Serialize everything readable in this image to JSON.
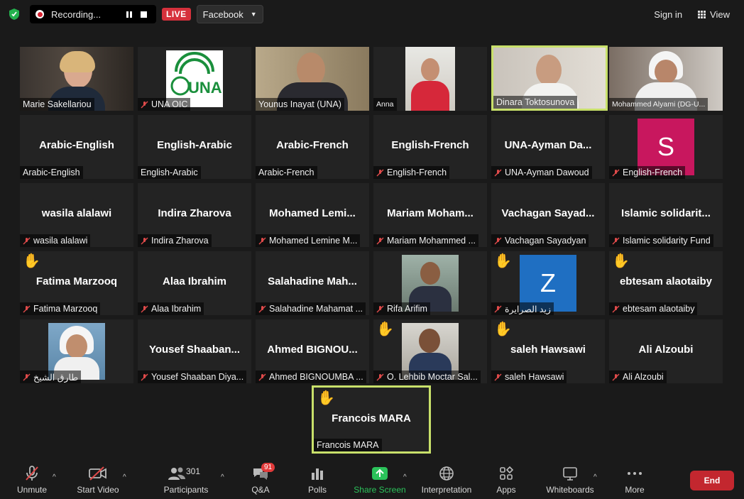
{
  "topbar": {
    "recording_label": "Recording...",
    "live_label": "LIVE",
    "stream_target": "Facebook",
    "signin_label": "Sign in",
    "view_label": "View"
  },
  "tiles": {
    "r1": [
      {
        "name": "Marie Sakellariou"
      },
      {
        "name": "UNA OIC",
        "logo": "UNA"
      },
      {
        "name": "Younus Inayat (UNA)"
      },
      {
        "name": "Anna"
      },
      {
        "name": "Dinara Toktosunova"
      },
      {
        "name": "Mohammed Alyami (DG-U..."
      }
    ],
    "r2": [
      {
        "center": "Arabic-English",
        "name": "Arabic-English"
      },
      {
        "center": "English-Arabic",
        "name": "English-Arabic"
      },
      {
        "center": "Arabic-French",
        "name": "Arabic-French"
      },
      {
        "center": "English-French",
        "name": "English-French"
      },
      {
        "center": "UNA-Ayman Da...",
        "name": "UNA-Ayman Dawoud"
      },
      {
        "initial": "S",
        "name": "English-French"
      }
    ],
    "r3": [
      {
        "center": "wasila alalawi",
        "name": "wasila alalawi"
      },
      {
        "center": "Indira Zharova",
        "name": "Indira Zharova"
      },
      {
        "center": "Mohamed  Lemi...",
        "name": "Mohamed Lemine M..."
      },
      {
        "center": "Mariam  Moham...",
        "name": "Mariam Mohammed ..."
      },
      {
        "center": "Vachagan  Sayad...",
        "name": "Vachagan Sayadyan"
      },
      {
        "center": "Islamic  solidarit...",
        "name": "Islamic solidarity Fund"
      }
    ],
    "r4": [
      {
        "center": "Fatima Marzooq",
        "name": "Fatima Marzooq"
      },
      {
        "center": "Alaa Ibrahim",
        "name": "Alaa Ibrahim"
      },
      {
        "center": "Salahadine  Mah...",
        "name": "Salahadine Mahamat ..."
      },
      {
        "name": "Rifa Arifim"
      },
      {
        "initial": "Z",
        "name": "زيد الصرايرة"
      },
      {
        "center": "ebtesam alaotaiby",
        "name": "ebtesam alaotaiby"
      }
    ],
    "r5": [
      {
        "name": "طارق الشيخ"
      },
      {
        "center": "Yousef  Shaaban...",
        "name": "Yousef Shaaban Diya..."
      },
      {
        "center": "Ahmed  BIGNOU...",
        "name": "Ahmed BIGNOUMBA ..."
      },
      {
        "name": "O. Lehbib Moctar Sal..."
      },
      {
        "center": "saleh Hawsawi",
        "name": "saleh Hawsawi"
      },
      {
        "center": "Ali Alzoubi",
        "name": "Ali Alzoubi"
      }
    ],
    "r6": [
      {
        "center": "Francois MARA",
        "name": "Francois MARA"
      }
    ]
  },
  "toolbar": {
    "unmute": "Unmute",
    "start_video": "Start Video",
    "participants": "Participants",
    "participants_count": "301",
    "qa": "Q&A",
    "qa_badge": "91",
    "polls": "Polls",
    "share_screen": "Share Screen",
    "interpretation": "Interpretation",
    "apps": "Apps",
    "whiteboards": "Whiteboards",
    "more": "More",
    "end": "End"
  },
  "colors": {
    "live": "#d6313c",
    "active_speaker": "#c8e06a",
    "share_green": "#2bc25a",
    "end_red": "#c3272f"
  }
}
